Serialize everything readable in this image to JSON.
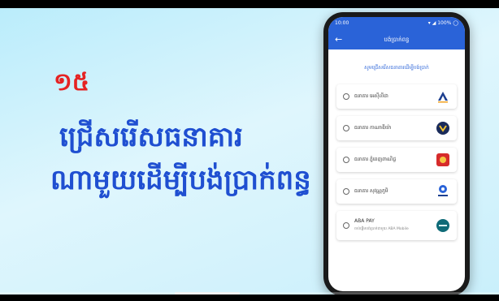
{
  "video": {
    "heading_number": "១៥",
    "heading_line1": "ជ្រើសរើសធនាគារ",
    "heading_line2": "ណាមួយដើម្បីបង់ប្រាក់ពន្ធ",
    "progress": 0.48
  },
  "phone": {
    "status": {
      "time": "10:00",
      "icons": "▾ ◢ 100% ◯"
    },
    "appbar": {
      "back": "←",
      "title": "បង់ប្រាក់ពន្ធ"
    },
    "subtitle": "សូមជ្រើសរើសធនាគារដើម្បីបង់ប្រាក់",
    "banks": [
      {
        "name": "ធនាគារ អេស៊ីលីដា",
        "logo": "acleda-logo"
      },
      {
        "name": "ធនាគារ កាណាឌីយ៉ា",
        "logo": "canadia-logo"
      },
      {
        "name": "ធនាគារ ភ្នំពេញពាណិជ្ជ",
        "logo": "ppcb-logo"
      },
      {
        "name": "ធនាគារ សុវណ្ណភូមិ",
        "logo": "wing-logo"
      },
      {
        "name": "ABA PAY",
        "sub": "ចាប់ផ្តើមបង់ប្រាក់ជាមួយ ABA Mobile",
        "logo": "aba-logo"
      }
    ],
    "colors": {
      "primary": "#2a63d8",
      "heading_red": "#e52323",
      "heading_blue": "#1f4fd1"
    }
  }
}
